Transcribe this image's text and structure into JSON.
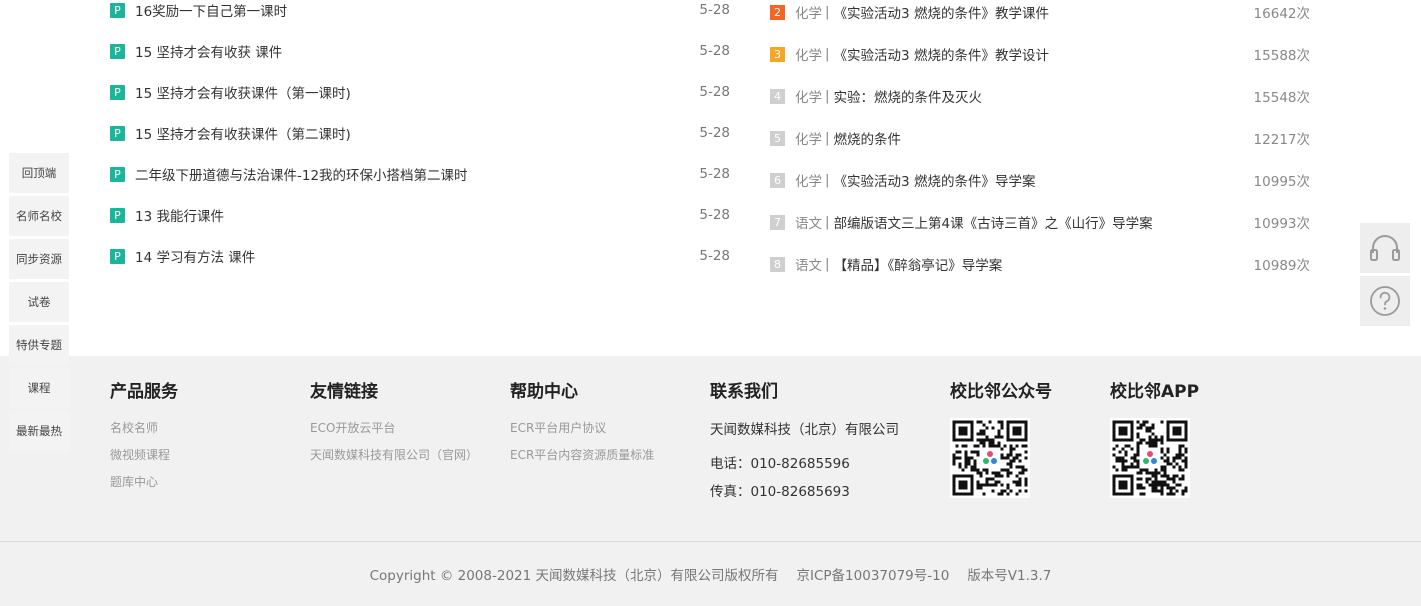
{
  "resources": [
    {
      "badge": "P",
      "title": "16奖励一下自己第一课时",
      "date": "5-28"
    },
    {
      "badge": "P",
      "title": "15 坚持才会有收获 课件",
      "date": "5-28"
    },
    {
      "badge": "P",
      "title": "15 坚持才会有收获课件（第一课时)",
      "date": "5-28"
    },
    {
      "badge": "P",
      "title": "15 坚持才会有收获课件（第二课时)",
      "date": "5-28"
    },
    {
      "badge": "P",
      "title": "二年级下册道德与法治课件-12我的环保小搭档第二课时",
      "date": "5-28"
    },
    {
      "badge": "P",
      "title": "13 我能行课件",
      "date": "5-28"
    },
    {
      "badge": "P",
      "title": "14 学习有方法 课件",
      "date": "5-28"
    }
  ],
  "rankings": [
    {
      "rank": "2",
      "subject": "化学",
      "sep": "|",
      "title": "《实验活动3 燃烧的条件》教学课件",
      "count": "16642次"
    },
    {
      "rank": "3",
      "subject": "化学",
      "sep": "|",
      "title": "《实验活动3 燃烧的条件》教学设计",
      "count": "15588次"
    },
    {
      "rank": "4",
      "subject": "化学",
      "sep": "|",
      "title": "实验：燃烧的条件及灭火",
      "count": "15548次"
    },
    {
      "rank": "5",
      "subject": "化学",
      "sep": "|",
      "title": "燃烧的条件",
      "count": "12217次"
    },
    {
      "rank": "6",
      "subject": "化学",
      "sep": "|",
      "title": "《实验活动3 燃烧的条件》导学案",
      "count": "10995次"
    },
    {
      "rank": "7",
      "subject": "语文",
      "sep": "|",
      "title": "部编版语文三上第4课《古诗三首》之《山行》导学案",
      "count": "10993次"
    },
    {
      "rank": "8",
      "subject": "语文",
      "sep": "|",
      "title": "【精品】《醉翁亭记》导学案",
      "count": "10989次"
    }
  ],
  "side_nav": [
    "回顶端",
    "名师名校",
    "同步资源",
    "试卷",
    "特供专题",
    "课程",
    "最新最热"
  ],
  "tools": {
    "headset_icon": "headset-icon",
    "help_icon": "question-icon"
  },
  "footer": {
    "products": {
      "heading": "产品服务",
      "links": [
        "名校名师",
        "微视频课程",
        "题库中心"
      ]
    },
    "friends": {
      "heading": "友情链接",
      "links": [
        "ECO开放云平台",
        "天闻数媒科技有限公司（官网）"
      ]
    },
    "help": {
      "heading": "帮助中心",
      "links": [
        "ECR平台用户协议",
        "ECR平台内容资源质量标准"
      ]
    },
    "contact": {
      "heading": "联系我们",
      "company": "天闻数媒科技（北京）有限公司",
      "phone": "电话：010-82685596",
      "fax": "传真：010-82685693"
    },
    "wechat": {
      "heading": "校比邻公众号"
    },
    "app": {
      "heading": "校比邻APP"
    },
    "copyright": "Copyright © 2008-2021 天闻数媒科技（北京）有限公司版权所有",
    "icp": "京ICP备10037079号-10",
    "version": "版本号V1.3.7"
  },
  "colors": {
    "badge_green": "#1bb59a",
    "rank_2": "#f26522",
    "rank_3": "#f5a623",
    "rank_other": "#cfcfcf",
    "footer_bg": "#f1f1f1"
  }
}
